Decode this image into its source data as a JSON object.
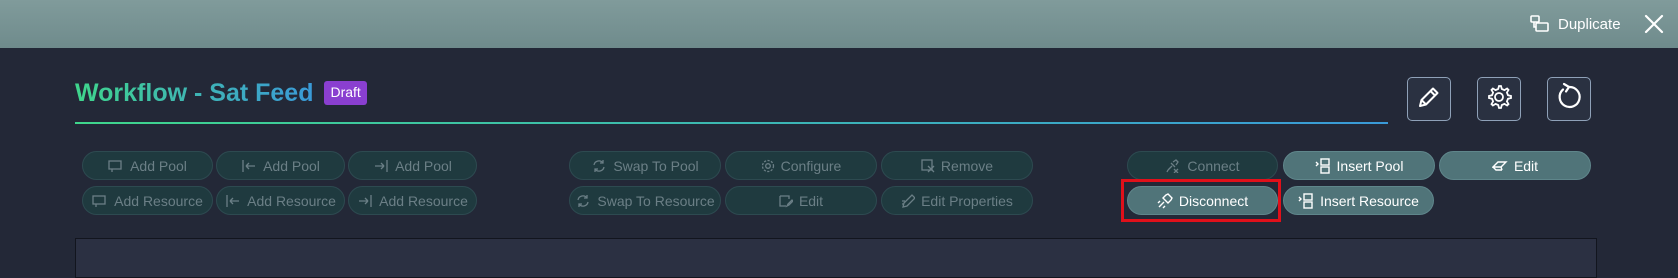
{
  "topbar": {
    "duplicate_label": "Duplicate",
    "icons": [
      "duplicate-icon",
      "close-icon"
    ]
  },
  "header": {
    "workflow_label": "Workflow",
    "separator": " - ",
    "workflow_name": "Sat Feed",
    "status_badge": "Draft",
    "accent_colors": [
      "#3fd68c",
      "#3a9ad8"
    ],
    "badge_color": "#8a3fd0",
    "actions": [
      "pencil-icon",
      "gear-icon",
      "refresh-icon"
    ]
  },
  "toolbar": {
    "group_add": [
      {
        "label": "Add Pool",
        "icon": "add-before-icon",
        "enabled": false
      },
      {
        "label": "Add Pool",
        "icon": "add-left-icon",
        "enabled": false
      },
      {
        "label": "Add Pool",
        "icon": "add-right-icon",
        "enabled": false
      },
      {
        "label": "Add Resource",
        "icon": "add-before-icon",
        "enabled": false
      },
      {
        "label": "Add Resource",
        "icon": "add-left-icon",
        "enabled": false
      },
      {
        "label": "Add Resource",
        "icon": "add-right-icon",
        "enabled": false
      }
    ],
    "group_modify": [
      {
        "label": "Swap To Pool",
        "icon": "swap-icon",
        "enabled": false
      },
      {
        "label": "Configure",
        "icon": "gear-icon",
        "enabled": false
      },
      {
        "label": "Remove",
        "icon": "remove-icon",
        "enabled": false
      },
      {
        "label": "Swap To Resource",
        "icon": "swap-icon",
        "enabled": false
      },
      {
        "label": "Edit",
        "icon": "edit-icon",
        "enabled": false
      },
      {
        "label": "Edit Properties",
        "icon": "edit-properties-icon",
        "enabled": false
      }
    ],
    "group_connect": [
      {
        "label": "Connect",
        "icon": "connect-icon",
        "enabled": false
      },
      {
        "label": "Insert Pool",
        "icon": "insert-icon",
        "enabled": true
      },
      {
        "label": "Edit",
        "icon": "eraser-icon",
        "enabled": true
      },
      {
        "label": "Disconnect",
        "icon": "disconnect-icon",
        "enabled": true,
        "highlighted": true
      },
      {
        "label": "Insert Resource",
        "icon": "insert-icon",
        "enabled": true
      }
    ],
    "disabled_color": "#6b7f86",
    "enabled_color": "#507479",
    "highlight_color": "#e0101a"
  }
}
